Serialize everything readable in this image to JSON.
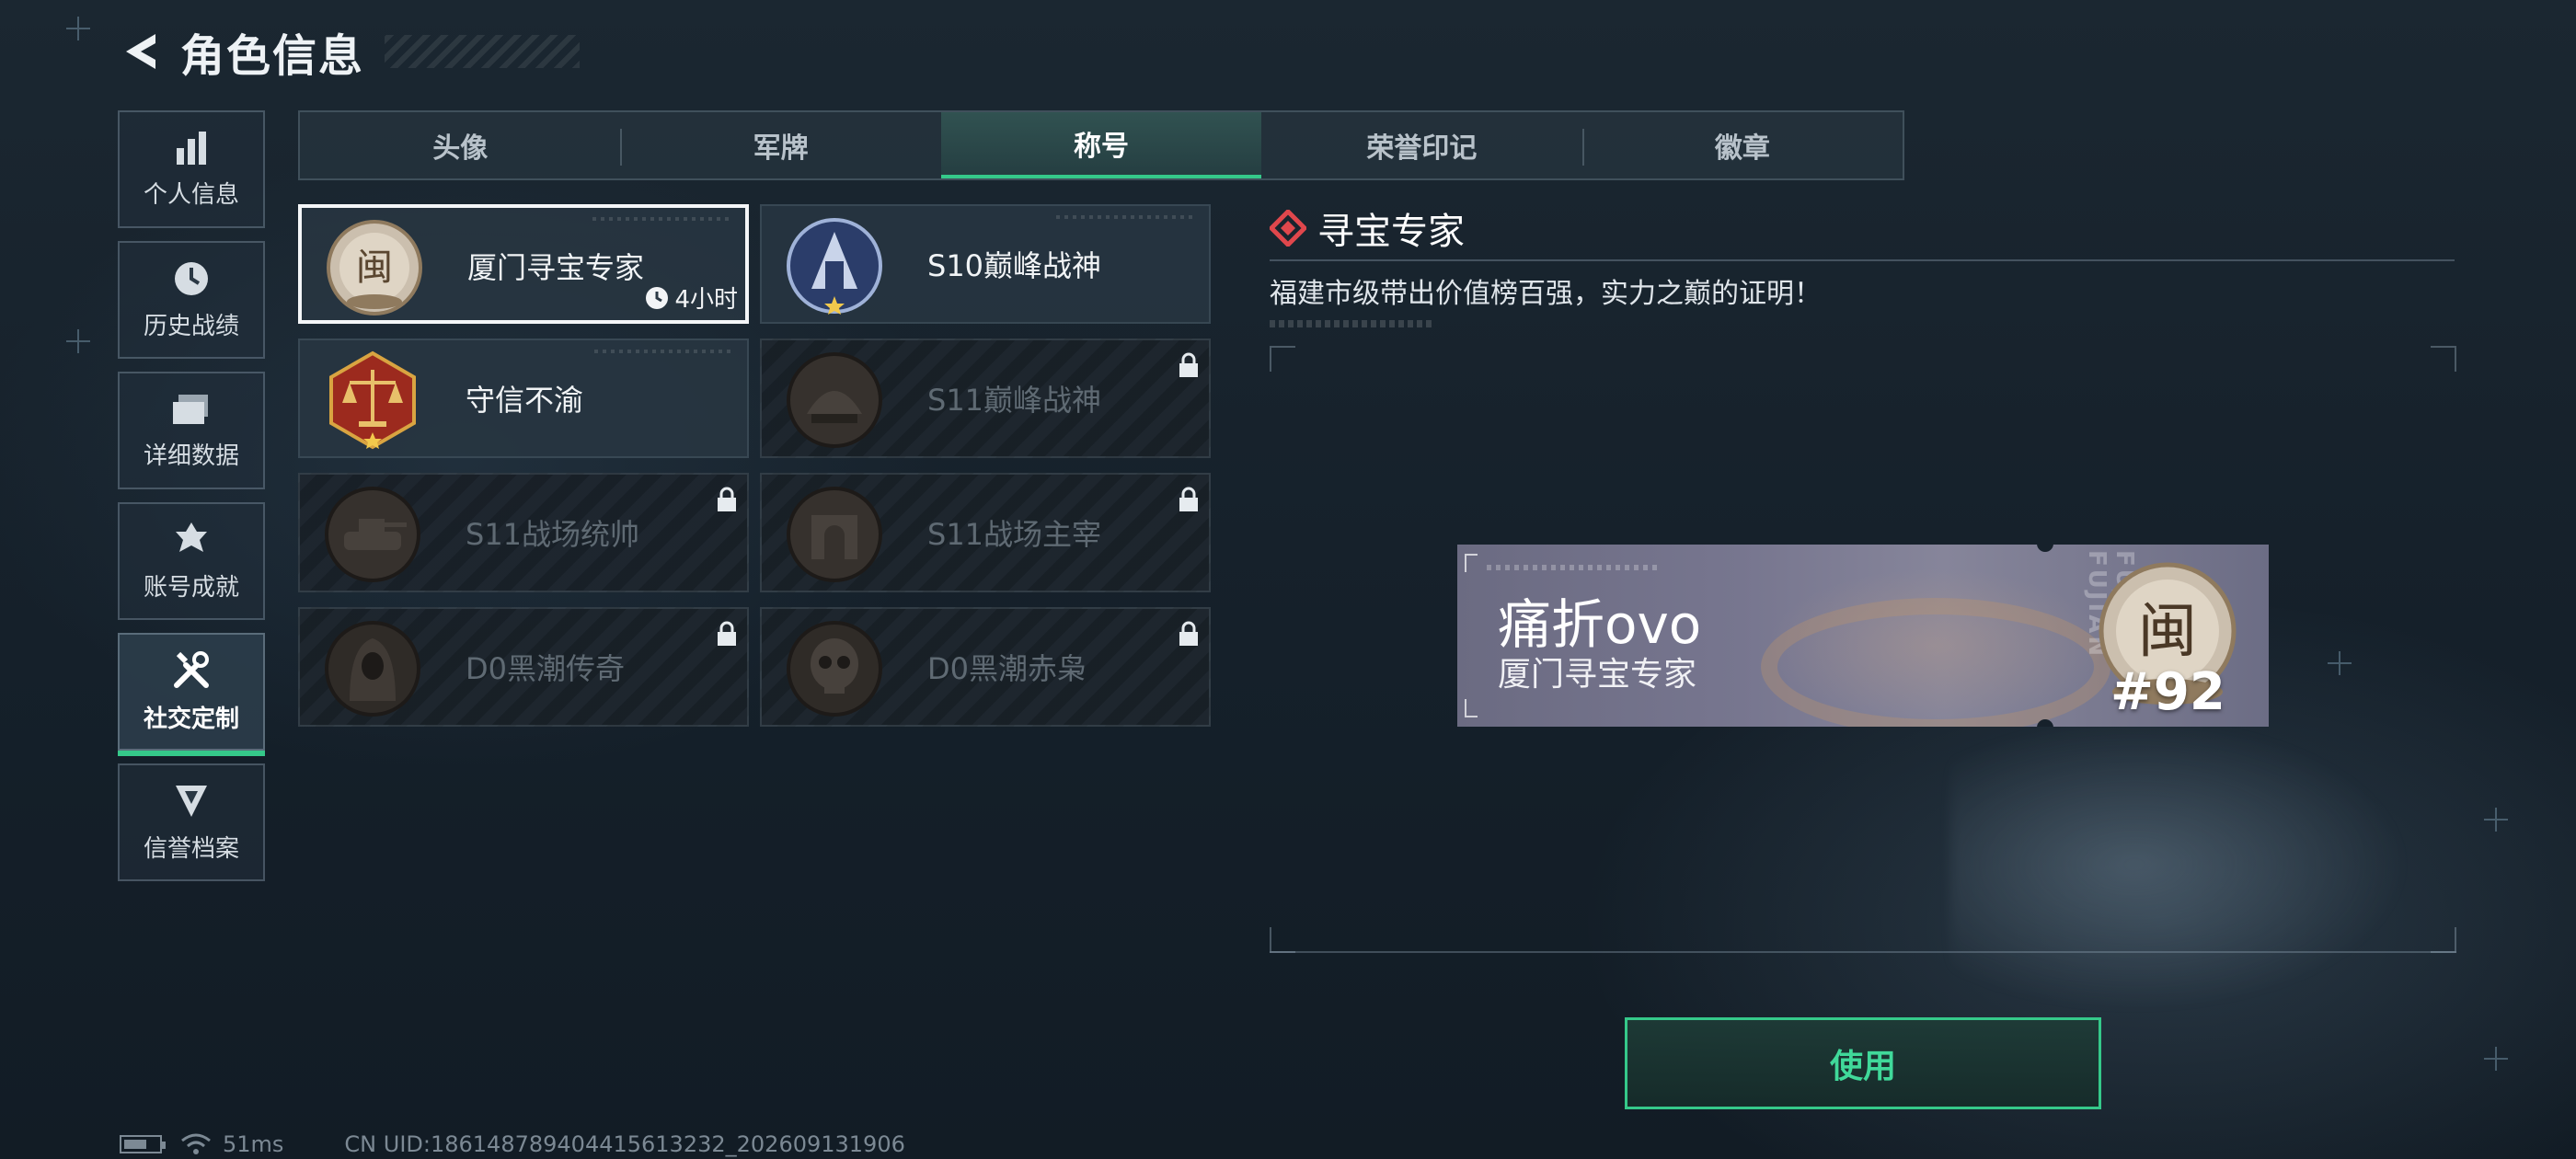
{
  "header": {
    "title": "角色信息"
  },
  "sidebar": {
    "items": [
      {
        "label": "个人信息",
        "icon": "bar-chart-icon"
      },
      {
        "label": "历史战绩",
        "icon": "clock-icon"
      },
      {
        "label": "详细数据",
        "icon": "folder-icon"
      },
      {
        "label": "账号成就",
        "icon": "achievement-icon"
      },
      {
        "label": "社交定制",
        "icon": "tools-icon",
        "active": true
      },
      {
        "label": "信誉档案",
        "icon": "shield-icon"
      }
    ]
  },
  "tabs": [
    {
      "label": "头像"
    },
    {
      "label": "军牌"
    },
    {
      "label": "称号",
      "active": true
    },
    {
      "label": "荣誉印记"
    },
    {
      "label": "徽章"
    }
  ],
  "titles": [
    {
      "name": "厦门寻宝专家",
      "timer": "4小时",
      "selected": true,
      "locked": false,
      "medal": "fujian-medal-icon"
    },
    {
      "name": "S10巅峰战神",
      "locked": false,
      "medal": "s10-peak-medal-icon"
    },
    {
      "name": "守信不渝",
      "locked": false,
      "medal": "scales-medal-icon"
    },
    {
      "name": "S11巅峰战神",
      "locked": true,
      "medal": "s11-peak-medal-icon"
    },
    {
      "name": "S11战场统帅",
      "locked": true,
      "medal": "tank-medal-icon"
    },
    {
      "name": "S11战场主宰",
      "locked": true,
      "medal": "arch-medal-icon"
    },
    {
      "name": "D0黑潮传奇",
      "locked": true,
      "medal": "hooded-figure-medal-icon"
    },
    {
      "name": "D0黑潮赤枭",
      "locked": true,
      "medal": "skull-medal-icon"
    }
  ],
  "detail": {
    "title": "寻宝专家",
    "description": "福建市级带出价值榜百强，实力之巅的证明！"
  },
  "preview": {
    "player_name": "痛折ovo",
    "title": "厦门寻宝专家",
    "vertical_text": "FUJIAN FUJIAN",
    "rank": "#92"
  },
  "actions": {
    "use_label": "使用"
  },
  "status": {
    "ping": "51ms",
    "uid": "CN UID:186148789404415613232_202609131906"
  },
  "colors": {
    "accent": "#35c98a",
    "medal_bronze": "#b08a5c",
    "diamond": "#e0474c"
  }
}
